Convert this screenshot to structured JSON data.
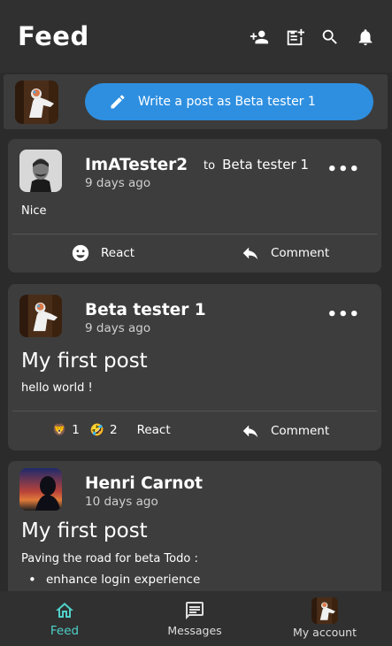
{
  "header": {
    "title": "Feed",
    "icons": [
      "add-friend-icon",
      "new-post-icon",
      "search-icon",
      "notifications-icon"
    ]
  },
  "composer": {
    "button_label": "Write a post as Beta tester 1",
    "button_color": "#2e8fe0"
  },
  "posts": [
    {
      "author": "ImATester2",
      "to_word": "to",
      "recipient": "Beta tester 1",
      "time": "9 days ago",
      "title": "",
      "body": "Nice",
      "react_label": "React",
      "comment_label": "Comment"
    },
    {
      "author": "Beta tester 1",
      "time": "9 days ago",
      "title": "My first post",
      "body": "hello world !",
      "reactions": [
        {
          "emoji": "🦁",
          "count": "1"
        },
        {
          "emoji": "🤣",
          "count": "2"
        }
      ],
      "react_label": "React",
      "comment_label": "Comment"
    },
    {
      "author": "Henri Carnot",
      "time": "10 days ago",
      "title": "My first post",
      "body": "Paving the road for beta Todo :",
      "bullets": [
        "enhance login experience"
      ]
    }
  ],
  "nav": {
    "feed": "Feed",
    "messages": "Messages",
    "account": "My account",
    "active_color": "#4fd0c8"
  }
}
